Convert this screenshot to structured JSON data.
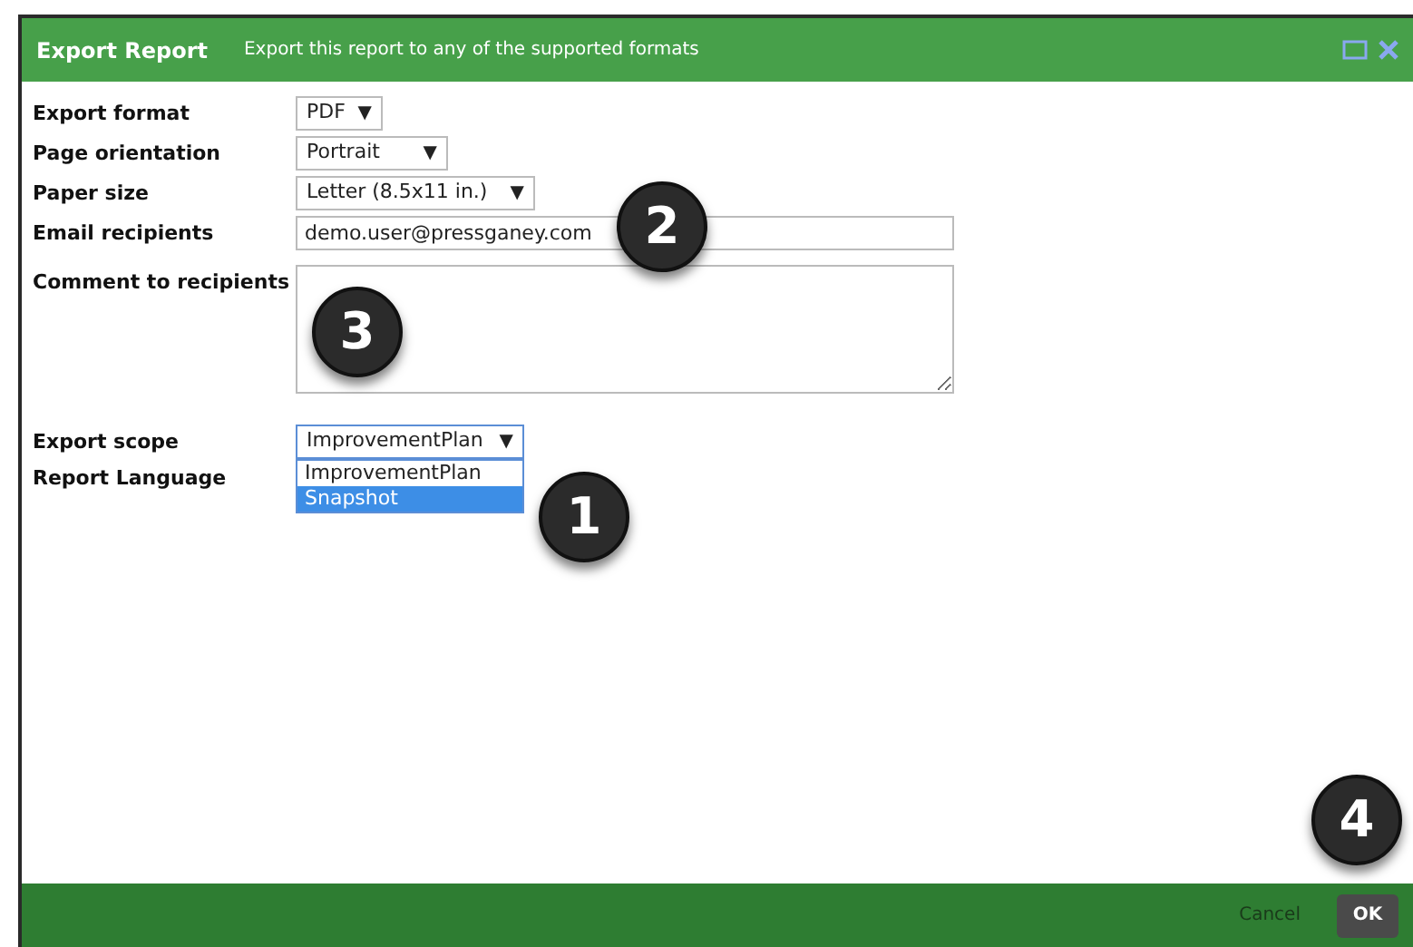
{
  "dialog": {
    "title": "Export Report",
    "subtitle": "Export this report to any of the supported formats"
  },
  "fields": [
    {
      "kind": "select",
      "label": "Export format",
      "value": "PDF",
      "arrow": "▼"
    },
    {
      "kind": "select",
      "label": "Page orientation",
      "value": "Portrait",
      "arrow": "▼"
    },
    {
      "kind": "select",
      "label": "Paper size",
      "value": "Letter (8.5x11 in.)",
      "arrow": "▼"
    },
    {
      "kind": "text",
      "label": "Email recipients",
      "value": "demo.user@pressganey.com"
    },
    {
      "kind": "textarea",
      "label": "Comment to recipients"
    },
    {
      "kind": "dropdown",
      "label": "Export scope",
      "value": "ImprovementPlan",
      "arrow": "▼",
      "expanded": true,
      "options": [
        {
          "label": "ImprovementPlan",
          "highlighted": false
        },
        {
          "label": "Snapshot",
          "highlighted": true
        }
      ]
    },
    {
      "kind": "label",
      "label": "Report Language"
    }
  ],
  "callouts": [
    "2",
    "3",
    "1",
    "4"
  ],
  "buttons": [
    {
      "kind": "link",
      "label": "Cancel"
    },
    {
      "kind": "primary",
      "label": "OK"
    }
  ]
}
